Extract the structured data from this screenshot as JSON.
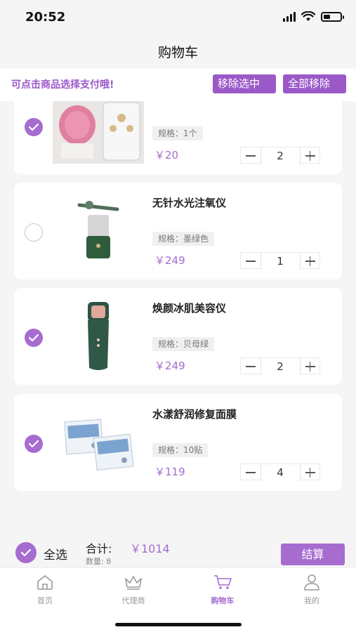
{
  "status": {
    "time": "20:52"
  },
  "header": {
    "title": "购物车"
  },
  "tip": {
    "text": "可点击商品选择支付哦!",
    "remove_selected": "移除选中",
    "remove_all": "全部移除"
  },
  "items": [
    {
      "title": "",
      "spec": "规格：1个",
      "price": "￥20",
      "qty": "2",
      "checked": true,
      "image": "pink-cleansing-brush-icon"
    },
    {
      "title": "无针水光注氧仪",
      "spec": "规格：墨绿色",
      "price": "￥249",
      "qty": "1",
      "checked": false,
      "image": "oxygen-injector-icon"
    },
    {
      "title": "焕颜冰肌美容仪",
      "spec": "规格：贝母绿",
      "price": "￥249",
      "qty": "2",
      "checked": true,
      "image": "beauty-device-icon"
    },
    {
      "title": "水漾舒润修复面膜",
      "spec": "规格：10贴",
      "price": "￥119",
      "qty": "4",
      "checked": true,
      "image": "face-mask-icon"
    }
  ],
  "summary": {
    "select_all": "全选",
    "total_label": "合计:",
    "total_value": "￥1014",
    "count_label": "数量: 8",
    "checkout": "结算"
  },
  "tabs": [
    {
      "label": "首页",
      "icon": "home-icon",
      "active": false
    },
    {
      "label": "代理商",
      "icon": "crown-icon",
      "active": false
    },
    {
      "label": "购物车",
      "icon": "cart-icon",
      "active": true
    },
    {
      "label": "我的",
      "icon": "user-icon",
      "active": false
    }
  ],
  "colors": {
    "accent": "#a66cd0",
    "tip": "#9b59c8"
  }
}
